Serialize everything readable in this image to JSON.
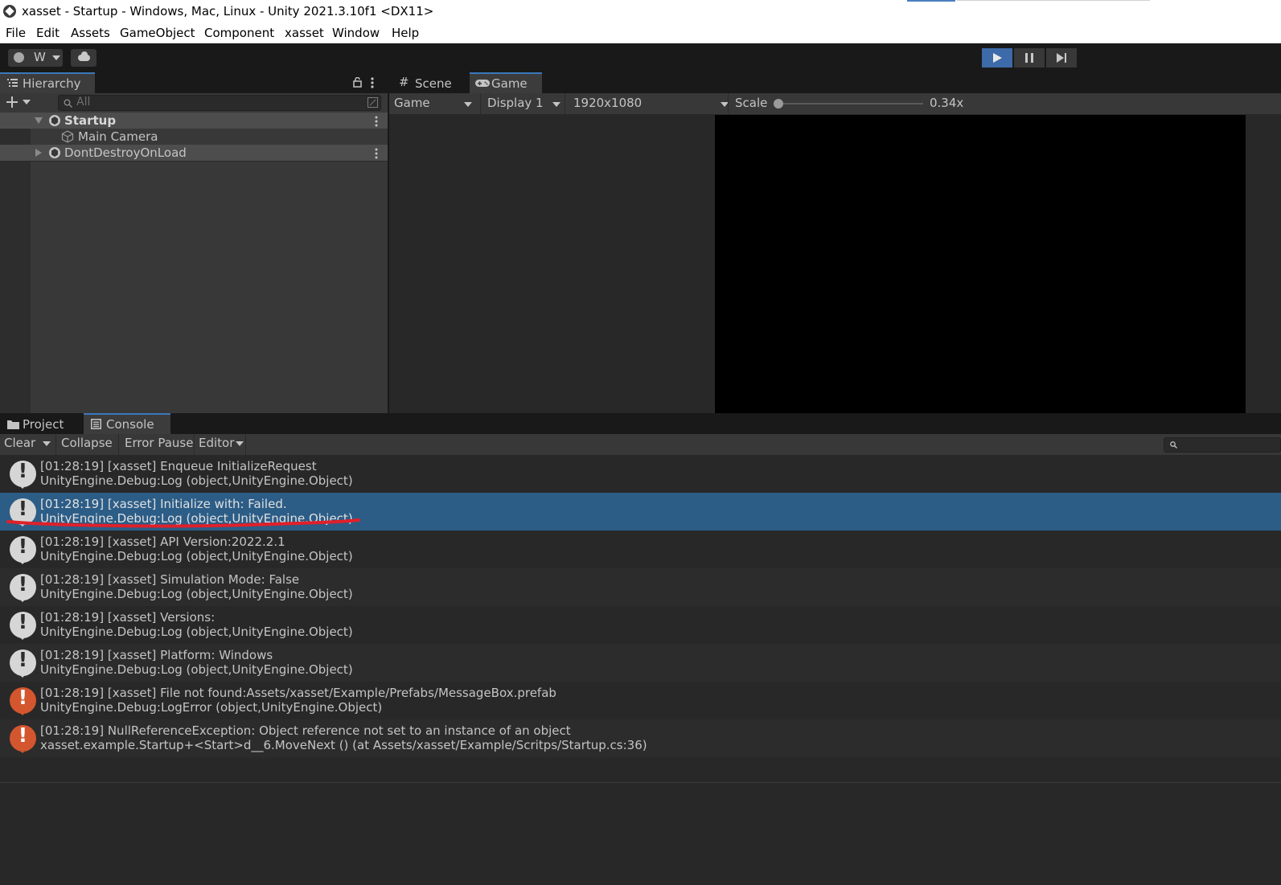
{
  "window": {
    "title": "xasset - Startup - Windows, Mac, Linux - Unity 2021.3.10f1 <DX11>"
  },
  "menu": [
    "File",
    "Edit",
    "Assets",
    "GameObject",
    "Component",
    "xasset",
    "Window",
    "Help"
  ],
  "toolbar": {
    "account_label": "W"
  },
  "hierarchy": {
    "tab_label": "Hierarchy",
    "search_placeholder": "All",
    "items": [
      {
        "label": "Startup"
      },
      {
        "label": "Main Camera"
      },
      {
        "label": "DontDestroyOnLoad"
      }
    ]
  },
  "game": {
    "tabs": [
      {
        "label": "Scene"
      },
      {
        "label": "Game"
      }
    ],
    "view_select": "Game",
    "display_select": "Display 1",
    "resolution_select": "1920x1080",
    "scale_label": "Scale",
    "scale_value": "0.34x"
  },
  "console": {
    "tabs": [
      {
        "label": "Project"
      },
      {
        "label": "Console"
      }
    ],
    "toolbar": {
      "clear": "Clear",
      "collapse": "Collapse",
      "error_pause": "Error Pause",
      "editor": "Editor"
    },
    "entries": [
      {
        "type": "info",
        "line1": "[01:28:19] [xasset] Enqueue InitializeRequest",
        "line2": "UnityEngine.Debug:Log (object,UnityEngine.Object)"
      },
      {
        "type": "info",
        "line1": "[01:28:19] [xasset] Initialize with: Failed.",
        "line2": "UnityEngine.Debug:Log (object,UnityEngine.Object)",
        "selected": true
      },
      {
        "type": "info",
        "line1": "[01:28:19] [xasset] API Version:2022.2.1",
        "line2": "UnityEngine.Debug:Log (object,UnityEngine.Object)"
      },
      {
        "type": "info",
        "line1": "[01:28:19] [xasset] Simulation Mode: False",
        "line2": "UnityEngine.Debug:Log (object,UnityEngine.Object)"
      },
      {
        "type": "info",
        "line1": "[01:28:19] [xasset] Versions:",
        "line2": "UnityEngine.Debug:Log (object,UnityEngine.Object)"
      },
      {
        "type": "info",
        "line1": "[01:28:19] [xasset] Platform: Windows",
        "line2": "UnityEngine.Debug:Log (object,UnityEngine.Object)"
      },
      {
        "type": "error",
        "line1": "[01:28:19] [xasset] File not found:Assets/xasset/Example/Prefabs/MessageBox.prefab",
        "line2": "UnityEngine.Debug:LogError (object,UnityEngine.Object)"
      },
      {
        "type": "error",
        "line1": "[01:28:19] NullReferenceException: Object reference not set to an instance of an object",
        "line2": "xasset.example.Startup+<Start>d__6.MoveNext () (at Assets/xasset/Example/Scritps/Startup.cs:36)"
      }
    ]
  },
  "colors": {
    "selection": "#2c5d87",
    "error_icon": "#d4562e",
    "annotation": "#e0202a",
    "play_active": "#3d6aa8"
  }
}
